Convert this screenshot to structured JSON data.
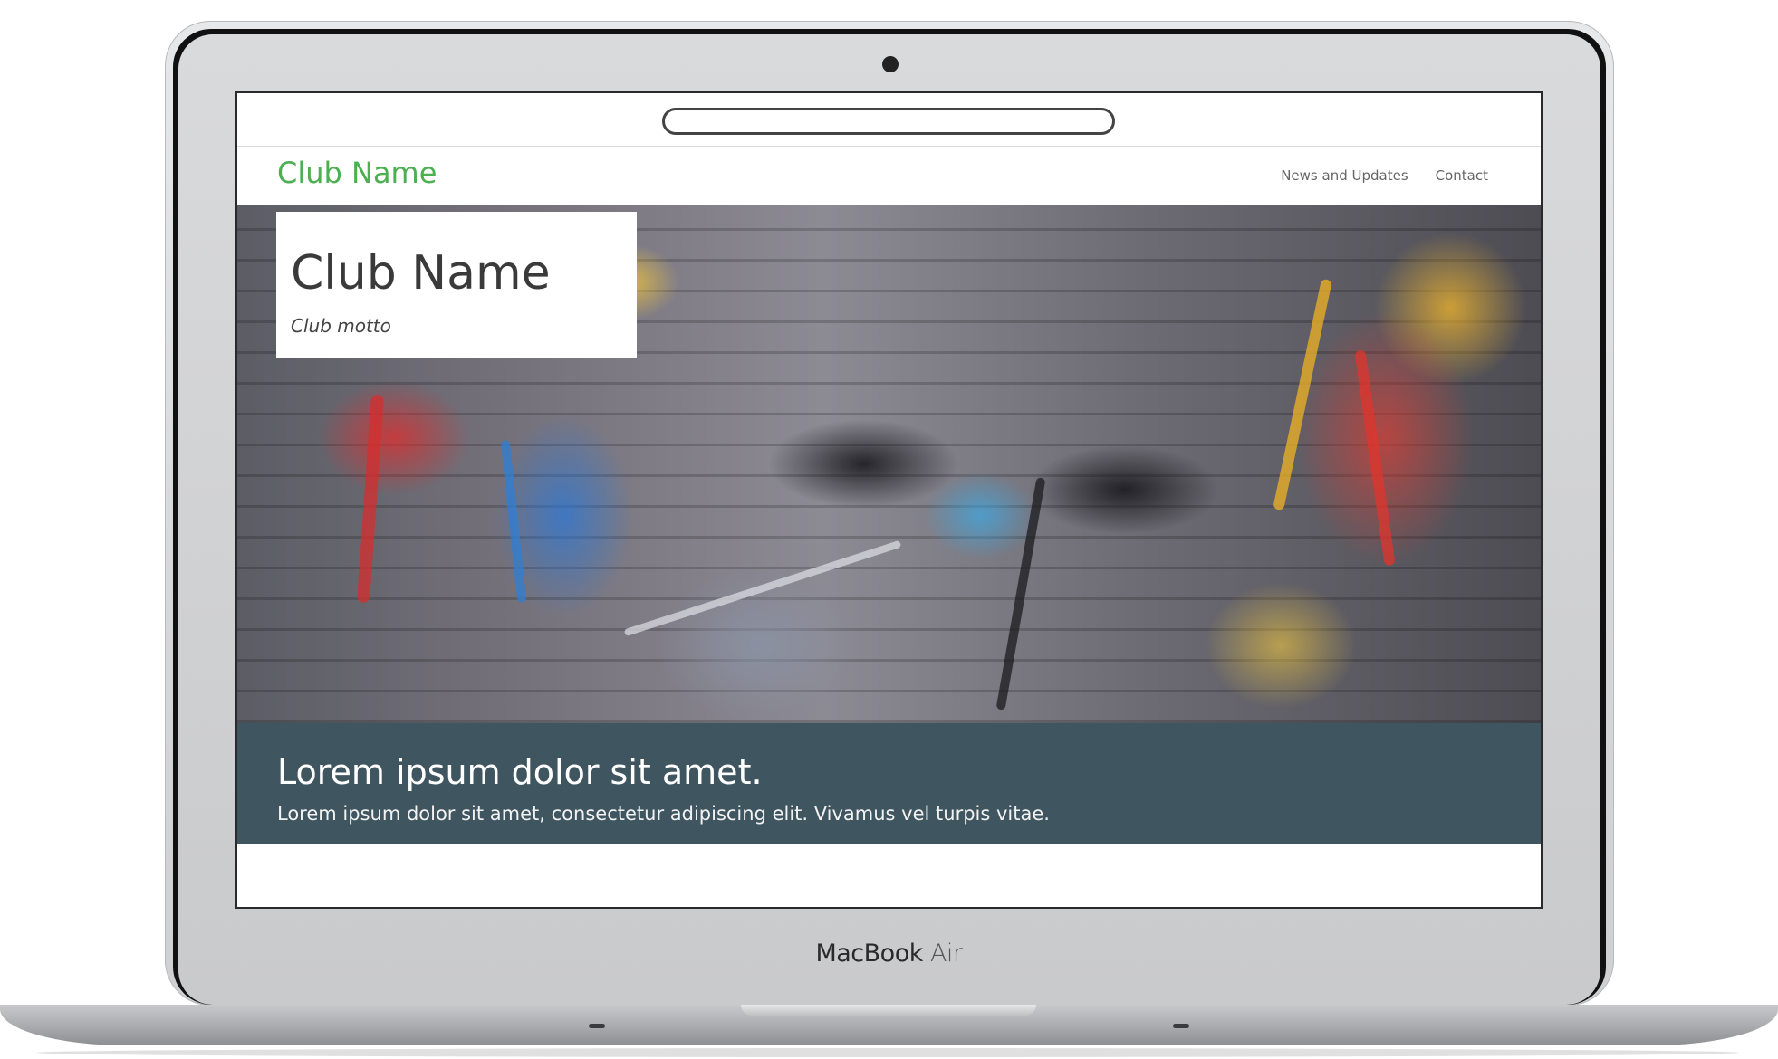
{
  "device": {
    "brand_primary": "MacBook",
    "brand_secondary": "Air"
  },
  "site": {
    "logo": "Club Name",
    "nav": [
      "News and Updates",
      "Contact"
    ],
    "hero": {
      "title": "Club Name",
      "motto": "Club motto"
    },
    "banner": {
      "heading": "Lorem ipsum dolor sit amet.",
      "text": "Lorem ipsum dolor sit amet, consectetur adipiscing elit. Vivamus vel turpis vitae."
    }
  },
  "colors": {
    "logo_green": "#4caf50",
    "banner_bg": "#3f5560"
  }
}
